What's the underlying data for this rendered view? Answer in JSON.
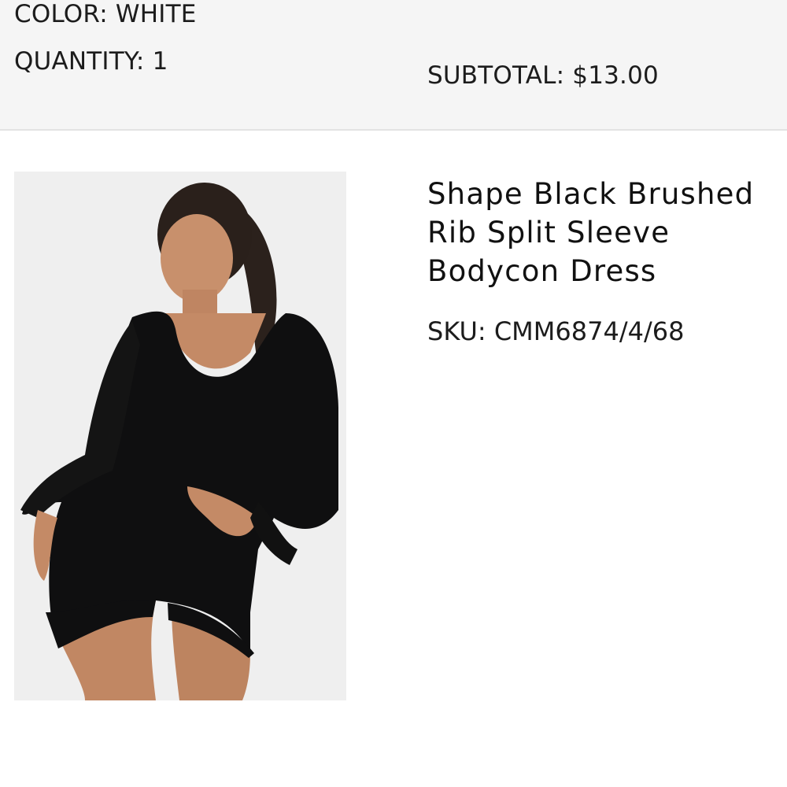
{
  "order_summary": {
    "color_text": "COLOR: WHITE",
    "quantity_text": "QUANTITY: 1",
    "subtotal_text": "SUBTOTAL: $13.00"
  },
  "product": {
    "title": "Shape Black Brushed Rib Split Sleeve Bodycon Dress",
    "sku_text": "SKU: CMM6874/4/68"
  }
}
